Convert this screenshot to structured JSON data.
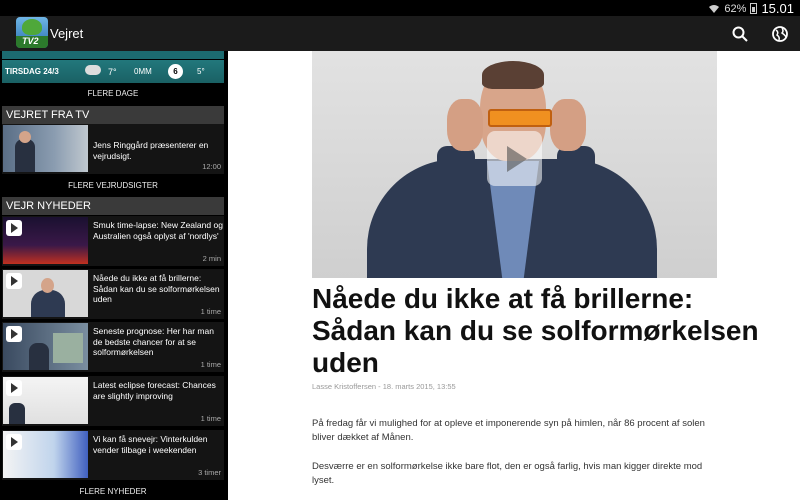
{
  "status_bar": {
    "battery": "62%",
    "time": "15.01"
  },
  "app_bar": {
    "title": "Vejret",
    "logo_text": "TV2"
  },
  "weather": {
    "day": "TIRSDAG 24/3",
    "temp": "7°",
    "rain": "0MM",
    "wind": "6",
    "wind_temp": "5°"
  },
  "more_days": "FLERE DAGE",
  "tv_section": {
    "header": "VEJRET FRA TV",
    "items": [
      {
        "title": "Jens Ringgård præsenterer en vejrudsigt.",
        "time": "12:00"
      }
    ],
    "more": "FLERE VEJRUDSIGTER"
  },
  "news_section": {
    "header": "VEJR NYHEDER",
    "items": [
      {
        "title": "Smuk time-lapse: New Zealand og Australien også oplyst af 'nordlys'",
        "time": "2 min"
      },
      {
        "title": "Nåede du ikke at få brillerne: Sådan kan du se solformørkelsen uden",
        "time": "1 time"
      },
      {
        "title": "Seneste prognose: Her har man de bedste chancer for at se solformørkelsen",
        "time": "1 time"
      },
      {
        "title": "Latest eclipse forecast: Chances are slightly improving",
        "time": "1 time"
      },
      {
        "title": "Vi kan få snevejr: Vinterkulden vender tilbage i weekenden",
        "time": "3 timer"
      }
    ],
    "more": "FLERE NYHEDER"
  },
  "article": {
    "title": "Nåede du ikke at få brillerne: Sådan kan du se solformørkelsen uden",
    "byline": "Lasse Kristoffersen - 18. marts 2015, 13:55",
    "paragraphs": [
      "På fredag får vi mulighed for at opleve et imponerende syn på himlen, når 86 procent af solen bliver dækket af Månen.",
      "Desværre er en solformørkelse ikke bare flot, den er også farlig, hvis man kigger direkte mod lyset."
    ]
  },
  "icons": [
    "wifi-icon",
    "battery-icon",
    "search-icon",
    "globe-icon",
    "play-icon",
    "cloud-icon"
  ]
}
